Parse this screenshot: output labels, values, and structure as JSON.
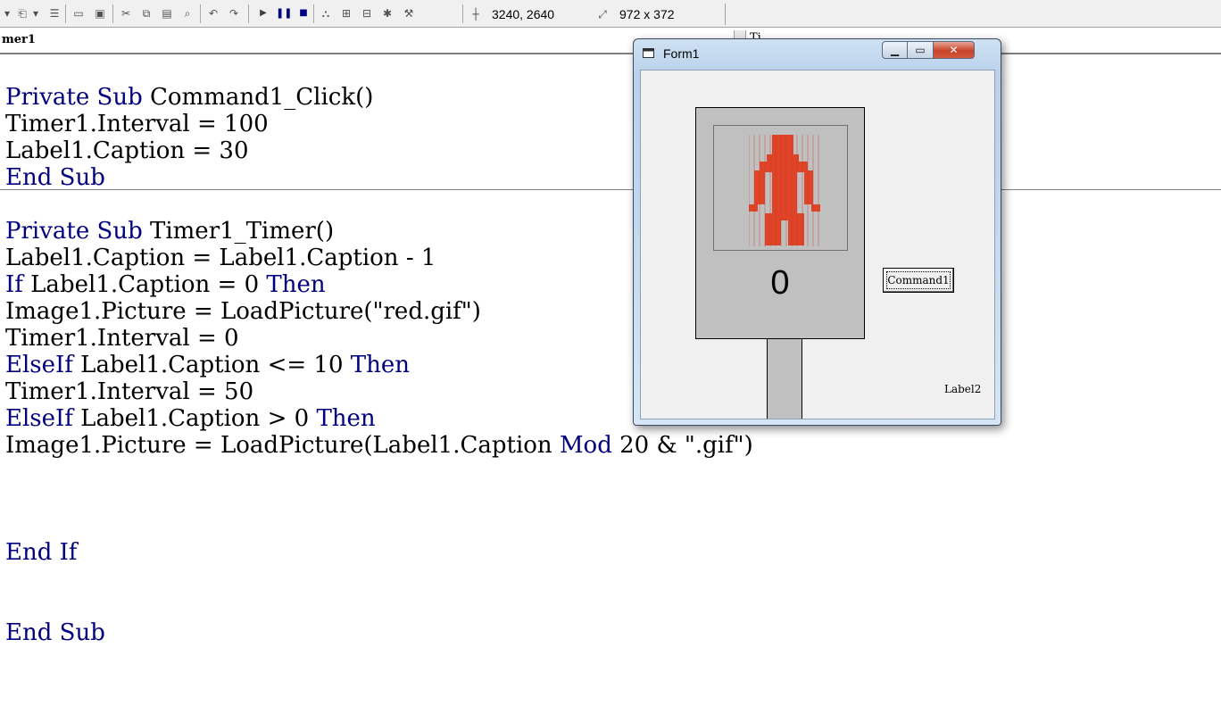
{
  "toolbar": {
    "coords": "3240, 2640",
    "size": "972 x 372"
  },
  "object_combo": {
    "value": "mer1"
  },
  "proc_combo": {
    "value": "Ti..."
  },
  "code": {
    "lines": [
      [
        {
          "t": "Private Sub",
          "k": true
        },
        {
          "t": " Command1_Click()",
          "k": false
        }
      ],
      [
        {
          "t": "Timer1.Interval = 100",
          "k": false
        }
      ],
      [
        {
          "t": "Label1.Caption = 30",
          "k": false
        }
      ],
      [
        {
          "t": "End Sub",
          "k": true
        }
      ],
      [],
      [
        {
          "t": "Private Sub",
          "k": true
        },
        {
          "t": " Timer1_Timer()",
          "k": false
        }
      ],
      [
        {
          "t": "Label1.Caption = Label1.Caption - 1",
          "k": false
        }
      ],
      [
        {
          "t": "If",
          "k": true
        },
        {
          "t": " Label1.Caption = 0 ",
          "k": false
        },
        {
          "t": "Then",
          "k": true
        }
      ],
      [
        {
          "t": "Image1.Picture = LoadPicture(\"red.gif\")",
          "k": false
        }
      ],
      [
        {
          "t": "Timer1.Interval = 0",
          "k": false
        }
      ],
      [
        {
          "t": "ElseIf",
          "k": true
        },
        {
          "t": " Label1.Caption <= 10 ",
          "k": false
        },
        {
          "t": "Then",
          "k": true
        }
      ],
      [
        {
          "t": "Timer1.Interval = 50",
          "k": false
        }
      ],
      [
        {
          "t": "ElseIf",
          "k": true
        },
        {
          "t": " Label1.Caption > 0 ",
          "k": false
        },
        {
          "t": "Then",
          "k": true
        }
      ],
      [
        {
          "t": "Image1.Picture = LoadPicture(Label1.Caption ",
          "k": false
        },
        {
          "t": "Mod",
          "k": true
        },
        {
          "t": " 20 & \".gif\")",
          "k": false
        }
      ],
      [],
      [],
      [],
      [
        {
          "t": "End If",
          "k": true
        }
      ],
      [],
      [],
      [
        {
          "t": "End Sub",
          "k": true
        }
      ]
    ]
  },
  "form": {
    "title": "Form1",
    "countdown": "0",
    "command_caption": "Command1",
    "label2": "Label2",
    "figure_color": "#e04428"
  },
  "colors": {
    "keyword": "#00007f",
    "form_bg": "#f0f0f0",
    "sign_gray": "#c0c0c0"
  }
}
